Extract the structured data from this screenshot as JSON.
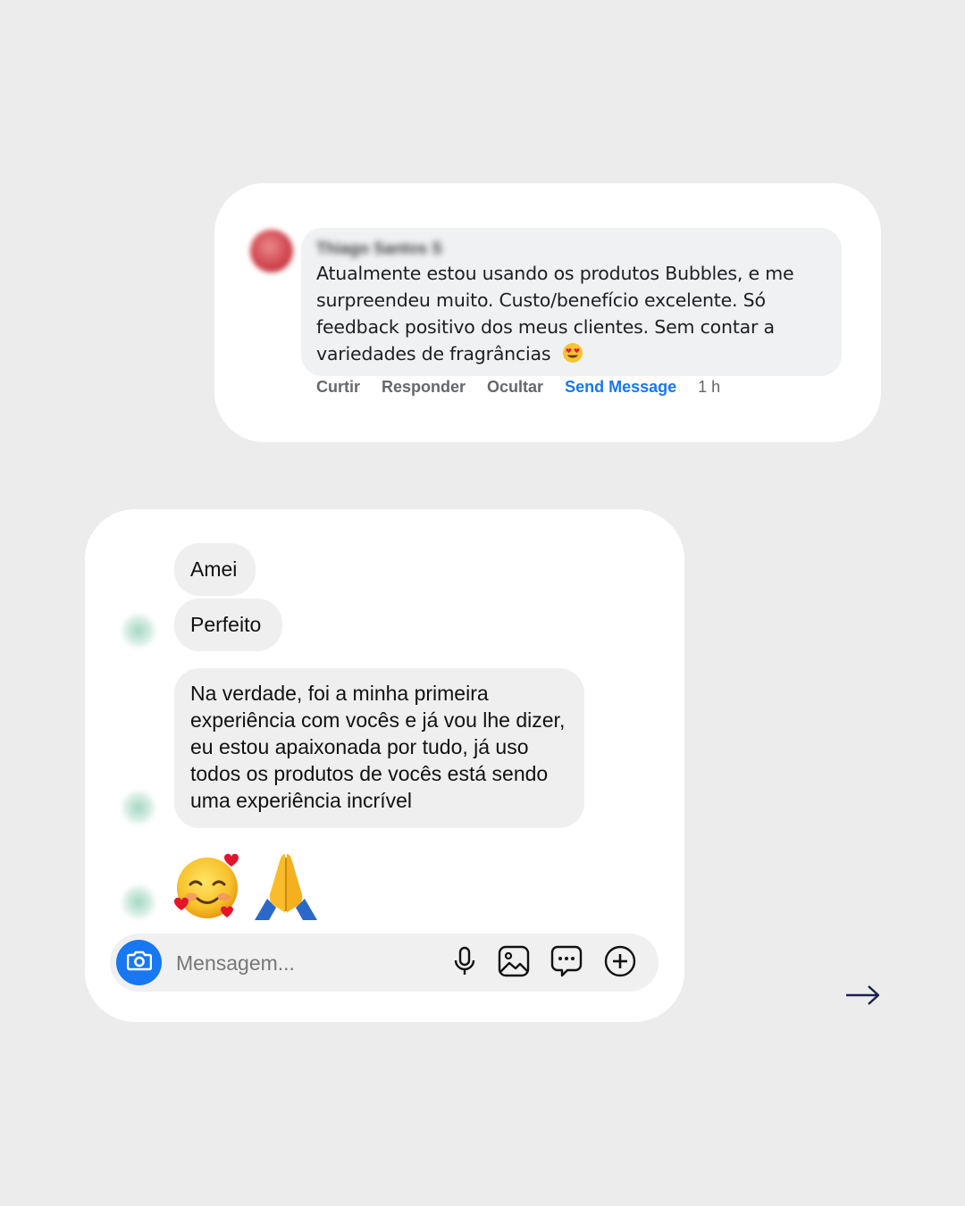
{
  "colors": {
    "background": "#ececec",
    "card": "#ffffff",
    "facebook_blue": "#1877f2",
    "action_gray": "#65676b",
    "arrow": "#1a1f4d"
  },
  "comment": {
    "author_name": "Thiago Santos S",
    "text": "Atualmente estou usando os produtos Bubbles, e me surpreendeu muito. Custo/benefício excelente. Só feedback positivo dos meus clientes. Sem contar a variedades de fragrâncias",
    "text_emoji": "heart-eyes-emoji",
    "actions": {
      "like": "Curtir",
      "reply": "Responder",
      "hide": "Ocultar",
      "send_message": "Send Message",
      "time": "1 h"
    }
  },
  "dm": {
    "messages": [
      {
        "text": "Amei"
      },
      {
        "text": "Perfeito"
      },
      {
        "text": "Na verdade, foi a minha primeira experiência com vocês e já vou lhe dizer, eu estou apaixonada por tudo, já uso todos os produtos de vocês está sendo uma experiência incrível"
      }
    ],
    "emoji_message": [
      "smiling-face-with-hearts-emoji",
      "folded-hands-emoji"
    ],
    "composer": {
      "placeholder": "Mensagem...",
      "icons": [
        "camera-icon",
        "microphone-icon",
        "image-icon",
        "sticker-icon",
        "plus-icon"
      ]
    }
  },
  "navigation": {
    "next_icon": "arrow-right-icon"
  }
}
